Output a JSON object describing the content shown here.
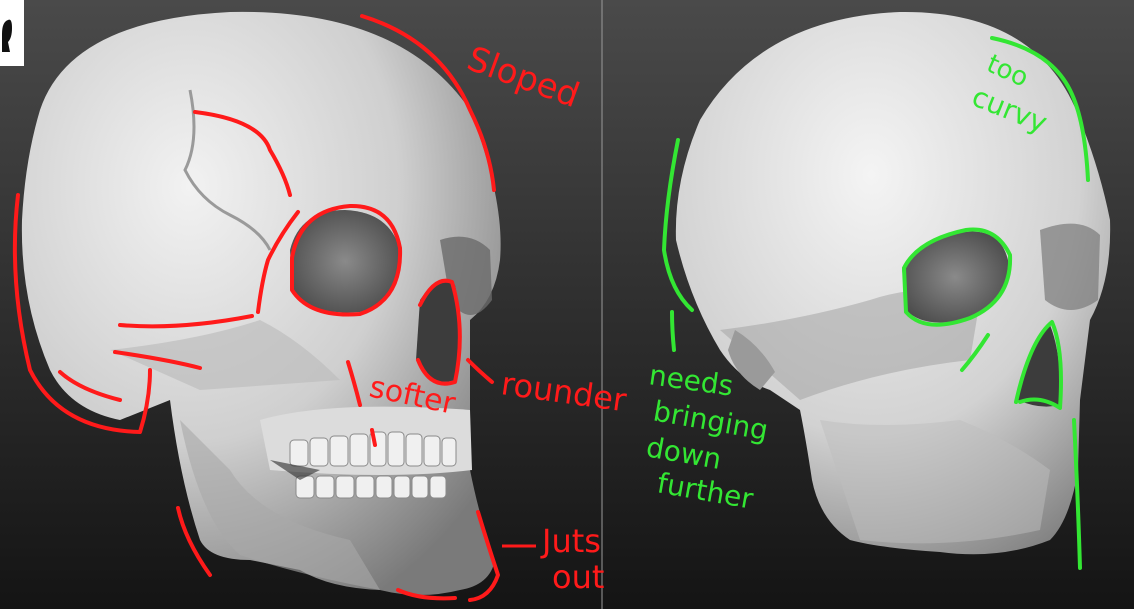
{
  "colors": {
    "background_top": "#4a4a4a",
    "background_bottom": "#141414",
    "reference_annotation": "#ff1a1a",
    "sculpt_annotation": "#33e633",
    "divider": "#9a9a9a",
    "skull_light": "#e9e9e9",
    "skull_shadow": "#5a5a5a"
  },
  "left_panel": {
    "image": "reference skull with red annotation strokes",
    "notes": {
      "sloped": "Sloped",
      "rounder": "rounder",
      "softer": "softer",
      "juts": "Juts",
      "out": "out"
    }
  },
  "right_panel": {
    "image": "sculpted skull model with green annotation strokes",
    "notes": {
      "too": "too",
      "curvy": "curvy",
      "needs": "needs",
      "bringing": "bringing",
      "down": "down",
      "further": "further"
    }
  },
  "corner_icon": "head-silhouette-icon"
}
